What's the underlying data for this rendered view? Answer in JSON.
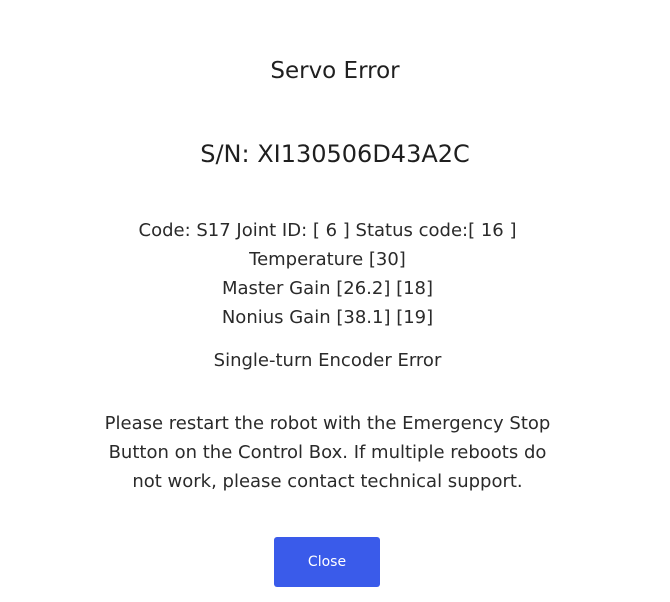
{
  "dialog": {
    "title": "Servo Error",
    "serial": "S/N: XI130506D43A2C",
    "details": {
      "code_line": "Code: S17 Joint ID: [ 6 ] Status code:[ 16 ]",
      "temperature": "Temperature [30]",
      "master_gain": "Master Gain [26.2] [18]",
      "nonius_gain": "Nonius Gain [38.1] [19]"
    },
    "error_type": "Single-turn Encoder Error",
    "instructions": "Please restart the robot with the Emergency Stop Button on the Control Box. If multiple reboots do not work, please contact technical support.",
    "close_label": "Close"
  },
  "colors": {
    "accent": "#3a5bea",
    "background": "#ffffff",
    "text": "#222222"
  }
}
